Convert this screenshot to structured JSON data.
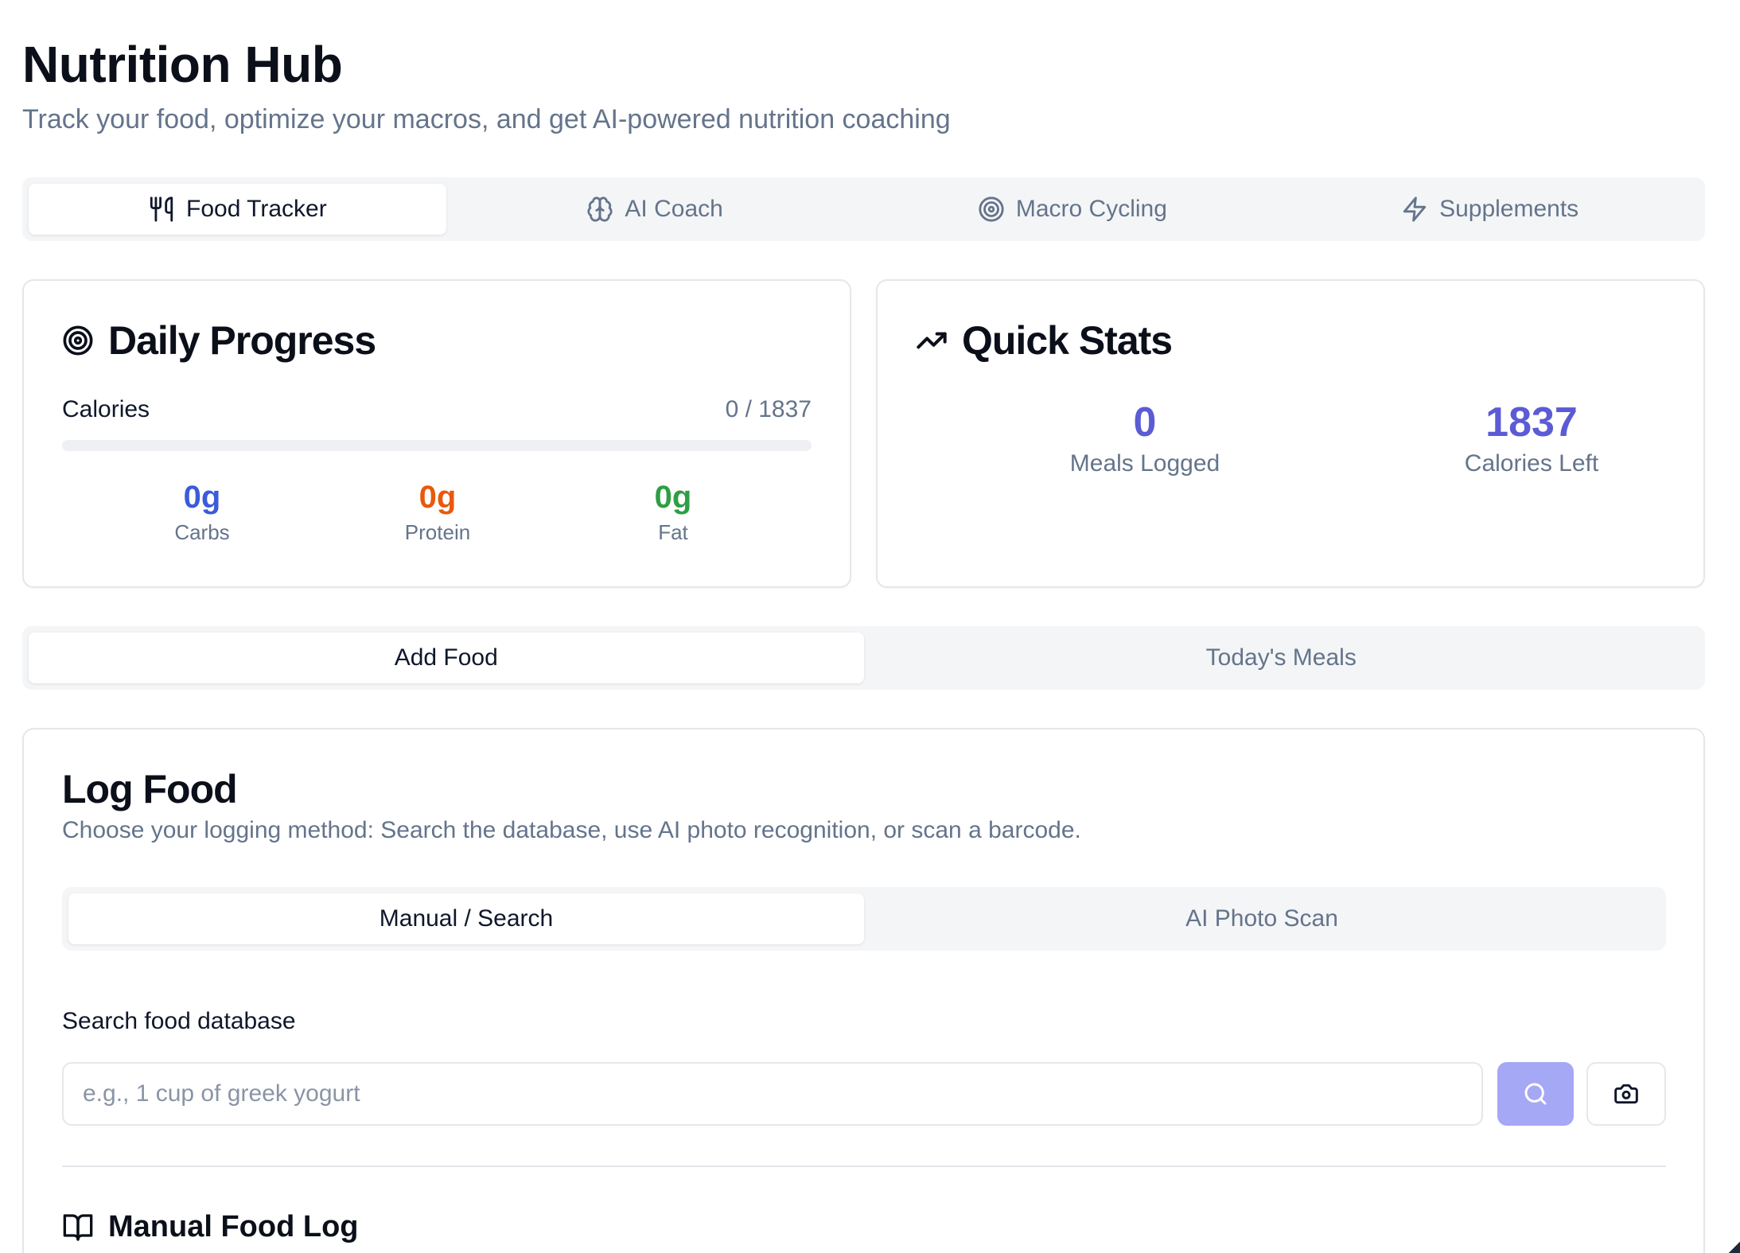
{
  "header": {
    "title": "Nutrition Hub",
    "subtitle": "Track your food, optimize your macros, and get AI-powered nutrition coaching"
  },
  "main_tabs": [
    {
      "label": "Food Tracker",
      "icon": "utensils-icon",
      "active": true
    },
    {
      "label": "AI Coach",
      "icon": "brain-icon",
      "active": false
    },
    {
      "label": "Macro Cycling",
      "icon": "target-icon",
      "active": false
    },
    {
      "label": "Supplements",
      "icon": "zap-icon",
      "active": false
    }
  ],
  "daily_progress": {
    "title": "Daily Progress",
    "icon": "target-icon",
    "calories_label": "Calories",
    "calories_value": "0 / 1837",
    "calories_progress": 0,
    "macros": [
      {
        "value": "0g",
        "label": "Carbs",
        "color": "#3b5bdb"
      },
      {
        "value": "0g",
        "label": "Protein",
        "color": "#e8590c"
      },
      {
        "value": "0g",
        "label": "Fat",
        "color": "#2f9e44"
      }
    ]
  },
  "quick_stats": {
    "title": "Quick Stats",
    "icon": "trending-up-icon",
    "stats": [
      {
        "value": "0",
        "label": "Meals Logged"
      },
      {
        "value": "1837",
        "label": "Calories Left"
      }
    ]
  },
  "food_tabs": [
    {
      "label": "Add Food",
      "active": true
    },
    {
      "label": "Today's Meals",
      "active": false
    }
  ],
  "log_food": {
    "title": "Log Food",
    "subtitle": "Choose your logging method: Search the database, use AI photo recognition, or scan a barcode.",
    "method_tabs": [
      {
        "label": "Manual / Search",
        "active": true
      },
      {
        "label": "AI Photo Scan",
        "active": false
      }
    ],
    "search_label": "Search food database",
    "search_placeholder": "e.g., 1 cup of greek yogurt",
    "search_value": "",
    "search_button_icon": "search-icon",
    "camera_button_icon": "camera-icon",
    "manual_title": "Manual Food Log",
    "manual_icon": "book-open-icon"
  },
  "colors": {
    "accent": "#5b5bd6",
    "accent_light": "#a5a8f5",
    "muted_text": "#64748b",
    "border": "#e5e7eb",
    "tab_bg": "#f4f5f7"
  }
}
